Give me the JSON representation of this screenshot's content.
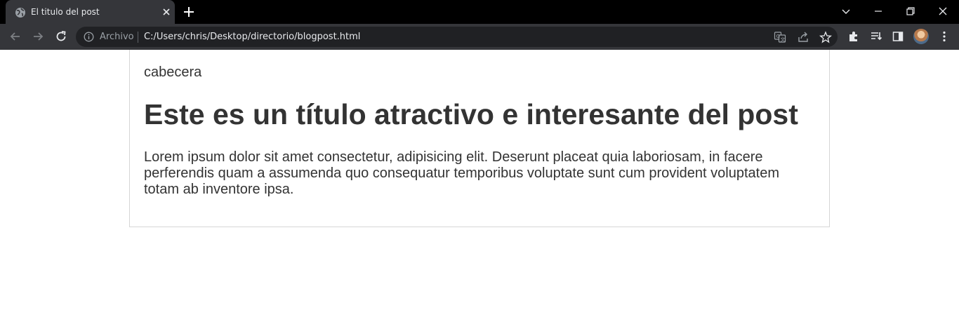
{
  "browser": {
    "tab": {
      "title": "El titulo del post",
      "favicon": "globe-icon"
    },
    "address_bar": {
      "scheme_label": "Archivo",
      "url": "C:/Users/chris/Desktop/directorio/blogpost.html"
    },
    "icons": {
      "back": "arrow-left-icon",
      "forward": "arrow-right-icon",
      "reload": "reload-icon",
      "translate": "translate-icon",
      "share": "share-icon",
      "bookmark": "star-icon",
      "extensions": "puzzle-icon",
      "reading_list": "reading-list-icon",
      "side_panel": "side-panel-icon",
      "menu": "kebab-menu-icon"
    },
    "colors": {
      "frame": "#000000",
      "toolbar": "#35363a",
      "omnibox": "#202124",
      "text": "#e8eaed"
    }
  },
  "page": {
    "header_text": "cabecera",
    "title": "Este es un título atractivo e interesante del post",
    "body": "Lorem ipsum dolor sit amet consectetur, adipisicing elit. Deserunt placeat quia laboriosam, in facere perferendis quam a assumenda quo consequatur temporibus voluptate sunt cum provident voluptatem totam ab inventore ipsa.",
    "text_color": "#333333",
    "border_color": "#d6d6d6"
  }
}
